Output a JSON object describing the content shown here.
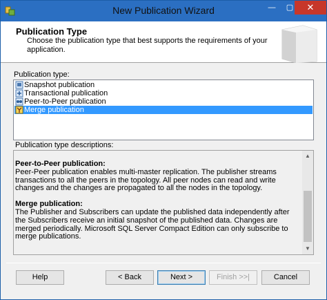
{
  "window": {
    "title": "New Publication Wizard",
    "buttons": {
      "minimize": "—",
      "maximize": "▢",
      "close": "✕"
    }
  },
  "header": {
    "title": "Publication Type",
    "description": "Choose the publication type that best supports the requirements of your application."
  },
  "publication_type": {
    "label": "Publication type:",
    "items": [
      {
        "label": "Snapshot publication",
        "selected": false
      },
      {
        "label": "Transactional publication",
        "selected": false
      },
      {
        "label": "Peer-to-Peer publication",
        "selected": false
      },
      {
        "label": "Merge publication",
        "selected": true
      }
    ]
  },
  "descriptions": {
    "label": "Publication type descriptions:",
    "sections": [
      {
        "heading": "Peer-to-Peer publication:",
        "body": "Peer-Peer publication enables multi-master replication. The publisher streams transactions to all the peers in the topology. All peer nodes can read and write changes and the changes are propagated to all the nodes in the topology."
      },
      {
        "heading": "Merge publication:",
        "body": "The Publisher and Subscribers can update the published data independently after the Subscribers receive an initial snapshot of the published data. Changes are merged periodically. Microsoft SQL Server Compact Edition can only subscribe to merge publications."
      }
    ]
  },
  "footer": {
    "help": "Help",
    "back": "< Back",
    "next": "Next >",
    "finish": "Finish >>|",
    "cancel": "Cancel"
  },
  "colors": {
    "selection": "#3399ff",
    "titlebar": "#2b6fc2",
    "close": "#c7372a"
  }
}
